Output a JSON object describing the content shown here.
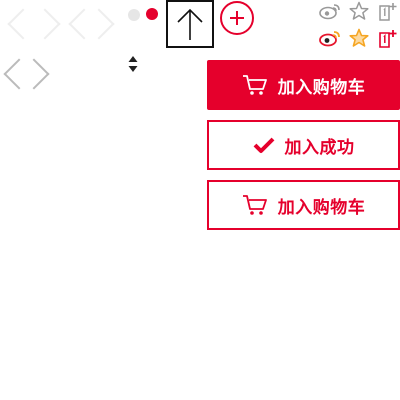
{
  "colors": {
    "brand_red": "#e5002c",
    "chevron_light": "#eeeeee",
    "chevron_mid": "#bbbbbb",
    "dot_inactive": "#e6e6e6",
    "share_gray": "#999999",
    "weibo_red": "#e6162d",
    "star_orange": "#f5a623"
  },
  "icons": {
    "prev_light": "chevron-left-icon",
    "next_light": "chevron-right-icon",
    "prev_mid": "chevron-left-icon",
    "next_mid": "chevron-right-icon",
    "back_to_top": "arrow-up-icon",
    "add": "plus-circle-icon",
    "sort": "sort-icon",
    "weibo": "weibo-icon",
    "favorite": "star-icon",
    "share_page": "share-page-icon",
    "cart": "cart-icon",
    "success": "check-icon"
  },
  "buttons": {
    "add_to_cart": "加入购物车",
    "add_success": "加入成功",
    "add_to_cart_outline": "加入购物车"
  }
}
